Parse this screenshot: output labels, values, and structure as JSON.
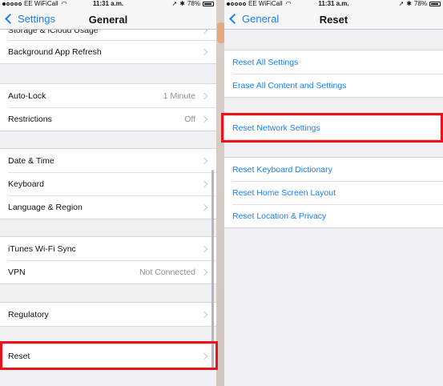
{
  "status_bar": {
    "carrier": "EE WiFiCall",
    "time": "11:31 a.m.",
    "battery": "78%",
    "signal_dots": 5,
    "signal_filled": 1
  },
  "left": {
    "nav": {
      "back_label": "Settings",
      "title": "General"
    },
    "partial_row": "Storage & iCloud Usage",
    "groups": [
      {
        "rows": [
          {
            "label": "Background App Refresh",
            "value": ""
          }
        ]
      },
      {
        "rows": [
          {
            "label": "Auto-Lock",
            "value": "1 Minute"
          },
          {
            "label": "Restrictions",
            "value": "Off"
          }
        ]
      },
      {
        "rows": [
          {
            "label": "Date & Time",
            "value": ""
          },
          {
            "label": "Keyboard",
            "value": ""
          },
          {
            "label": "Language & Region",
            "value": ""
          }
        ]
      },
      {
        "rows": [
          {
            "label": "iTunes Wi-Fi Sync",
            "value": ""
          },
          {
            "label": "VPN",
            "value": "Not Connected"
          }
        ]
      },
      {
        "rows": [
          {
            "label": "Regulatory",
            "value": ""
          }
        ]
      },
      {
        "rows": [
          {
            "label": "Reset",
            "value": ""
          }
        ]
      }
    ]
  },
  "right": {
    "nav": {
      "back_label": "General",
      "title": "Reset"
    },
    "groups": [
      {
        "rows": [
          {
            "label": "Reset All Settings"
          },
          {
            "label": "Erase All Content and Settings"
          }
        ]
      },
      {
        "rows": [
          {
            "label": "Reset Network Settings"
          }
        ]
      },
      {
        "rows": [
          {
            "label": "Reset Keyboard Dictionary"
          },
          {
            "label": "Reset Home Screen Layout"
          },
          {
            "label": "Reset Location & Privacy"
          }
        ]
      }
    ]
  },
  "colors": {
    "accent": "#157efb",
    "highlight": "#e8141c",
    "background": "#efeff4"
  }
}
